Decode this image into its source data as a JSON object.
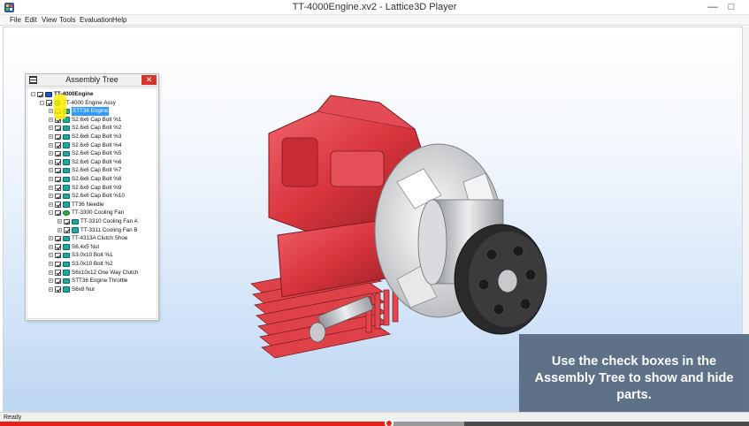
{
  "window": {
    "title": "TT-4000Engine.xv2 - Lattice3D Player",
    "minimize_glyph": "—",
    "maximize_glyph": "□"
  },
  "menu": {
    "items": [
      "File",
      "Edit",
      "View",
      "Tools",
      "Evaluation",
      "Help"
    ]
  },
  "assembly_tree": {
    "title": "Assembly Tree",
    "close_glyph": "✕",
    "rows": [
      {
        "label": "TT-4000Engine",
        "depth": 0,
        "expander": "−",
        "icon": "root-assembly-icon",
        "bold": true
      },
      {
        "label": "TT-4000 Engine Assy",
        "depth": 1,
        "expander": "−",
        "icon": "assembly-icon"
      },
      {
        "label": "STT36 Engine",
        "depth": 2,
        "expander": "+",
        "icon": "part-icon",
        "selected": true
      },
      {
        "label": "S2.6x6 Cap Bolt %1",
        "depth": 2,
        "expander": "+",
        "icon": "part-icon"
      },
      {
        "label": "S2.6x6 Cap Bolt %2",
        "depth": 2,
        "expander": "+",
        "icon": "part-icon"
      },
      {
        "label": "S2.6x6 Cap Bolt %3",
        "depth": 2,
        "expander": "+",
        "icon": "part-icon"
      },
      {
        "label": "S2.6x6 Cap Bolt %4",
        "depth": 2,
        "expander": "+",
        "icon": "part-icon"
      },
      {
        "label": "S2.6x6 Cap Bolt %5",
        "depth": 2,
        "expander": "+",
        "icon": "part-icon"
      },
      {
        "label": "S2.6x6 Cap Bolt %6",
        "depth": 2,
        "expander": "+",
        "icon": "part-icon"
      },
      {
        "label": "S2.6x6 Cap Bolt %7",
        "depth": 2,
        "expander": "+",
        "icon": "part-icon"
      },
      {
        "label": "S2.6x6 Cap Bolt %8",
        "depth": 2,
        "expander": "+",
        "icon": "part-icon"
      },
      {
        "label": "S2.6x6 Cap Bolt %9",
        "depth": 2,
        "expander": "+",
        "icon": "part-icon"
      },
      {
        "label": "S2.6x6 Cap Bolt %10",
        "depth": 2,
        "expander": "+",
        "icon": "part-icon"
      },
      {
        "label": "TT36 Needle",
        "depth": 2,
        "expander": "+",
        "icon": "part-icon"
      },
      {
        "label": "TT-3300 Cooling Fan",
        "depth": 2,
        "expander": "−",
        "icon": "assembly-icon"
      },
      {
        "label": "TT-3310 Cooling Fan A",
        "depth": 3,
        "expander": "+",
        "icon": "part-icon"
      },
      {
        "label": "TT-3311 Cooling Fan B",
        "depth": 3,
        "expander": "+",
        "icon": "part-icon"
      },
      {
        "label": "TT-4313A Clutch Shoe",
        "depth": 2,
        "expander": "+",
        "icon": "part-icon"
      },
      {
        "label": "S6.4x5 Nut",
        "depth": 2,
        "expander": "+",
        "icon": "part-icon"
      },
      {
        "label": "S3.0x10 Bolt %1",
        "depth": 2,
        "expander": "+",
        "icon": "part-icon"
      },
      {
        "label": "S3.0x10 Bolt %2",
        "depth": 2,
        "expander": "+",
        "icon": "part-icon"
      },
      {
        "label": "S6x10x12 One Way Clutch",
        "depth": 2,
        "expander": "+",
        "icon": "part-icon"
      },
      {
        "label": "STT36 Engine Throttle",
        "depth": 2,
        "expander": "+",
        "icon": "part-icon"
      },
      {
        "label": "S6x8 Nut",
        "depth": 2,
        "expander": "+",
        "icon": "part-icon"
      }
    ]
  },
  "caption": {
    "text": "Use the check boxes in the Assembly Tree to show and hide parts."
  },
  "status": {
    "text": "Ready"
  },
  "video": {
    "played_fraction": 0.52,
    "buffered_fraction": 0.62
  },
  "colors": {
    "engine_red": "#d8343c",
    "selection": "#3399ff",
    "caption_bg": "#5c6e86",
    "progress_red": "#e62117"
  }
}
